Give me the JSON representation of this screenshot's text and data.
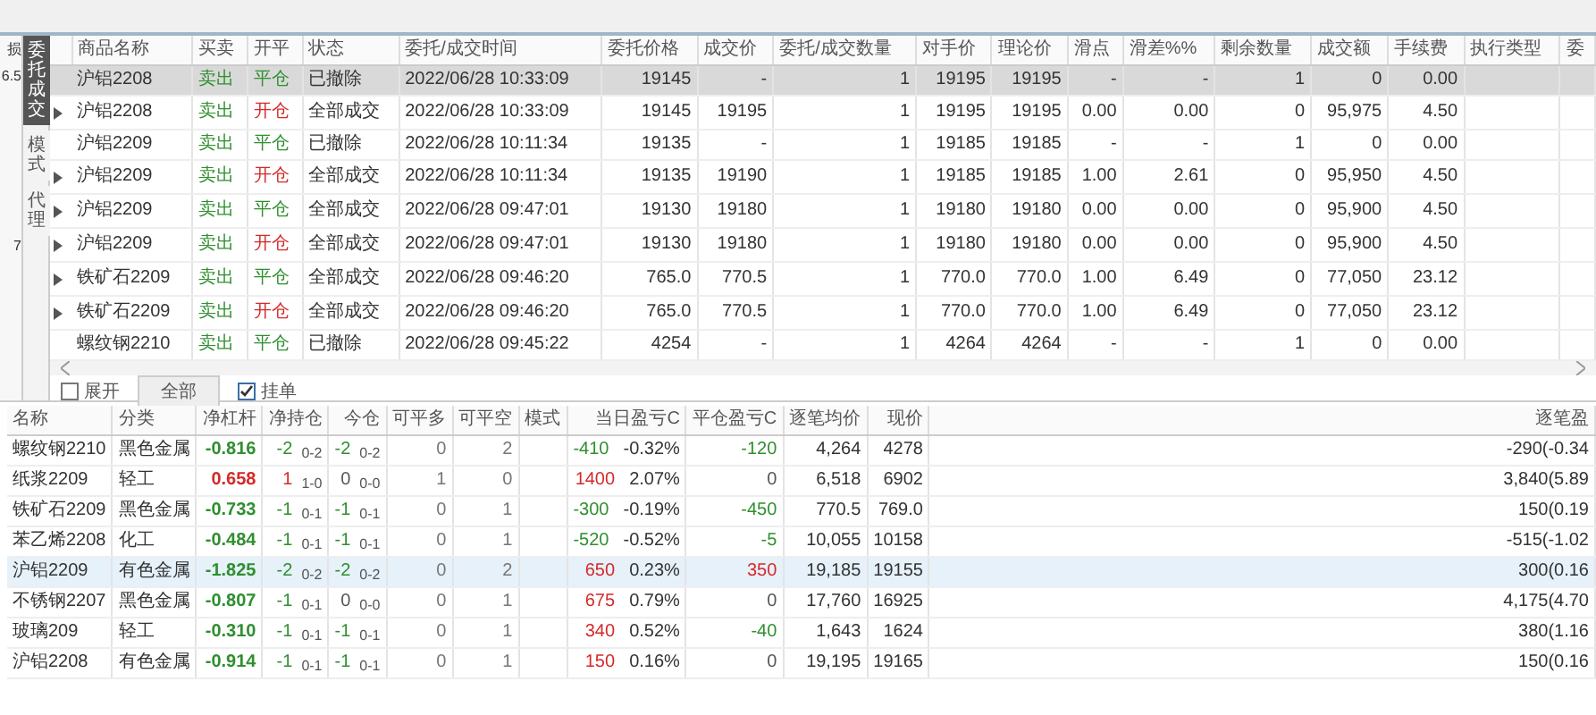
{
  "left_panel": {
    "header": "损",
    "value": "6.5",
    "footer": "7"
  },
  "side_tabs": [
    {
      "label": "委托成交",
      "selected": true
    },
    {
      "label": "模式",
      "selected": false
    },
    {
      "label": "代理",
      "selected": false
    }
  ],
  "orders": {
    "columns": [
      "商品名称",
      "买卖",
      "开平",
      "状态",
      "委托/成交时间",
      "委托价格",
      "成交价",
      "委托/成交数量",
      "对手价",
      "理论价",
      "滑点",
      "滑差%%",
      "剩余数量",
      "成交额",
      "手续费",
      "执行类型",
      "委"
    ],
    "rows": [
      {
        "expandable": false,
        "selected": true,
        "cells": [
          "沪铝2208",
          {
            "text": "卖出",
            "color": "#2f8f2f"
          },
          {
            "text": "平仓",
            "color": "#2f8f2f"
          },
          "已撤除",
          "2022/06/28 10:33:09",
          "19145",
          "-",
          "1",
          "19195",
          "19195",
          "-",
          "-",
          "1",
          "0",
          "0.00"
        ]
      },
      {
        "expandable": true,
        "selected": false,
        "cells": [
          "沪铝2208",
          {
            "text": "卖出",
            "color": "#2f8f2f"
          },
          {
            "text": "开仓",
            "color": "#d42a2a"
          },
          "全部成交",
          "2022/06/28 10:33:09",
          "19145",
          "19195",
          "1",
          "19195",
          "19195",
          "0.00",
          "0.00",
          "0",
          "95,975",
          "4.50"
        ]
      },
      {
        "expandable": false,
        "selected": false,
        "cells": [
          "沪铝2209",
          {
            "text": "卖出",
            "color": "#2f8f2f"
          },
          {
            "text": "平仓",
            "color": "#2f8f2f"
          },
          "已撤除",
          "2022/06/28 10:11:34",
          "19135",
          "-",
          "1",
          "19185",
          "19185",
          "-",
          "-",
          "1",
          "0",
          "0.00"
        ]
      },
      {
        "expandable": true,
        "selected": false,
        "cells": [
          "沪铝2209",
          {
            "text": "卖出",
            "color": "#2f8f2f"
          },
          {
            "text": "开仓",
            "color": "#d42a2a"
          },
          "全部成交",
          "2022/06/28 10:11:34",
          "19135",
          "19190",
          "1",
          "19185",
          "19185",
          "1.00",
          "2.61",
          "0",
          "95,950",
          "4.50"
        ]
      },
      {
        "expandable": true,
        "selected": false,
        "cells": [
          "沪铝2209",
          {
            "text": "卖出",
            "color": "#2f8f2f"
          },
          {
            "text": "平仓",
            "color": "#2f8f2f"
          },
          "全部成交",
          "2022/06/28 09:47:01",
          "19130",
          "19180",
          "1",
          "19180",
          "19180",
          "0.00",
          "0.00",
          "0",
          "95,900",
          "4.50"
        ]
      },
      {
        "expandable": true,
        "selected": false,
        "cells": [
          "沪铝2209",
          {
            "text": "卖出",
            "color": "#2f8f2f"
          },
          {
            "text": "开仓",
            "color": "#d42a2a"
          },
          "全部成交",
          "2022/06/28 09:47:01",
          "19130",
          "19180",
          "1",
          "19180",
          "19180",
          "0.00",
          "0.00",
          "0",
          "95,900",
          "4.50"
        ]
      },
      {
        "expandable": true,
        "selected": false,
        "cells": [
          "铁矿石2209",
          {
            "text": "卖出",
            "color": "#2f8f2f"
          },
          {
            "text": "平仓",
            "color": "#2f8f2f"
          },
          "全部成交",
          "2022/06/28 09:46:20",
          "765.0",
          "770.5",
          "1",
          "770.0",
          "770.0",
          "1.00",
          "6.49",
          "0",
          "77,050",
          "23.12"
        ]
      },
      {
        "expandable": true,
        "selected": false,
        "cells": [
          "铁矿石2209",
          {
            "text": "卖出",
            "color": "#2f8f2f"
          },
          {
            "text": "开仓",
            "color": "#d42a2a"
          },
          "全部成交",
          "2022/06/28 09:46:20",
          "765.0",
          "770.5",
          "1",
          "770.0",
          "770.0",
          "1.00",
          "6.49",
          "0",
          "77,050",
          "23.12"
        ]
      },
      {
        "expandable": false,
        "selected": false,
        "cells": [
          "螺纹钢2210",
          {
            "text": "卖出",
            "color": "#2f8f2f"
          },
          {
            "text": "平仓",
            "color": "#2f8f2f"
          },
          "已撤除",
          "2022/06/28 09:45:22",
          "4254",
          "-",
          "1",
          "4264",
          "4264",
          "-",
          "-",
          "1",
          "0",
          "0.00"
        ]
      }
    ]
  },
  "toolbar": [
    {
      "kind": "checkbox",
      "label": "展开",
      "checked": false
    },
    {
      "kind": "button",
      "label": "全部"
    },
    {
      "kind": "checkbox",
      "label": "挂单",
      "checked": true
    }
  ],
  "positions": {
    "columns": [
      "名称",
      "分类",
      "净杠杆",
      "净持仓",
      "今仓",
      "可平多",
      "可平空",
      "模式",
      "当日盈亏C",
      "平仓盈亏C",
      "逐笔均价",
      "现价",
      "逐笔盈"
    ],
    "rows": [
      {
        "selected": false,
        "cells": [
          "螺纹钢2210",
          "黑色金属",
          {
            "text": "-0.816",
            "color": "#2f8f2f"
          },
          {
            "value": "-2",
            "detail": "0-2",
            "color": "#2f8f2f"
          },
          {
            "value": "-2",
            "detail": "0-2",
            "color": "#2f8f2f"
          },
          "0",
          "2",
          "",
          {
            "value": "-410",
            "percent": "-0.32%",
            "color": "#2f8f2f"
          },
          {
            "text": "-120",
            "color": "#2f8f2f"
          },
          "4,264",
          "4278",
          "-290(-0.34"
        ]
      },
      {
        "selected": false,
        "cells": [
          "纸浆2209",
          "轻工",
          {
            "text": "0.658",
            "color": "#d42a2a"
          },
          {
            "value": "1",
            "detail": "1-0",
            "color": "#d42a2a"
          },
          {
            "value": "0",
            "detail": "0-0",
            "color": "#555555"
          },
          "1",
          "0",
          "",
          {
            "value": "1400",
            "percent": "2.07%",
            "color": "#d42a2a"
          },
          {
            "text": "0",
            "color": "#555555"
          },
          "6,518",
          "6902",
          "3,840(5.89"
        ]
      },
      {
        "selected": false,
        "cells": [
          "铁矿石2209",
          "黑色金属",
          {
            "text": "-0.733",
            "color": "#2f8f2f"
          },
          {
            "value": "-1",
            "detail": "0-1",
            "color": "#2f8f2f"
          },
          {
            "value": "-1",
            "detail": "0-1",
            "color": "#2f8f2f"
          },
          "0",
          "1",
          "",
          {
            "value": "-300",
            "percent": "-0.19%",
            "color": "#2f8f2f"
          },
          {
            "text": "-450",
            "color": "#2f8f2f"
          },
          "770.5",
          "769.0",
          "150(0.19"
        ]
      },
      {
        "selected": false,
        "cells": [
          "苯乙烯2208",
          "化工",
          {
            "text": "-0.484",
            "color": "#2f8f2f"
          },
          {
            "value": "-1",
            "detail": "0-1",
            "color": "#2f8f2f"
          },
          {
            "value": "-1",
            "detail": "0-1",
            "color": "#2f8f2f"
          },
          "0",
          "1",
          "",
          {
            "value": "-520",
            "percent": "-0.52%",
            "color": "#2f8f2f"
          },
          {
            "text": "-5",
            "color": "#2f8f2f"
          },
          "10,055",
          "10158",
          "-515(-1.02"
        ]
      },
      {
        "selected": true,
        "cells": [
          "沪铝2209",
          "有色金属",
          {
            "text": "-1.825",
            "color": "#2f8f2f"
          },
          {
            "value": "-2",
            "detail": "0-2",
            "color": "#2f8f2f"
          },
          {
            "value": "-2",
            "detail": "0-2",
            "color": "#2f8f2f"
          },
          "0",
          "2",
          "",
          {
            "value": "650",
            "percent": "0.23%",
            "color": "#d42a2a"
          },
          {
            "text": "350",
            "color": "#d42a2a"
          },
          "19,185",
          "19155",
          "300(0.16"
        ]
      },
      {
        "selected": false,
        "cells": [
          "不锈钢2207",
          "黑色金属",
          {
            "text": "-0.807",
            "color": "#2f8f2f"
          },
          {
            "value": "-1",
            "detail": "0-1",
            "color": "#2f8f2f"
          },
          {
            "value": "0",
            "detail": "0-0",
            "color": "#555555"
          },
          "0",
          "1",
          "",
          {
            "value": "675",
            "percent": "0.79%",
            "color": "#d42a2a"
          },
          {
            "text": "0",
            "color": "#555555"
          },
          "17,760",
          "16925",
          "4,175(4.70"
        ]
      },
      {
        "selected": false,
        "cells": [
          "玻璃209",
          "轻工",
          {
            "text": "-0.310",
            "color": "#2f8f2f"
          },
          {
            "value": "-1",
            "detail": "0-1",
            "color": "#2f8f2f"
          },
          {
            "value": "-1",
            "detail": "0-1",
            "color": "#2f8f2f"
          },
          "0",
          "1",
          "",
          {
            "value": "340",
            "percent": "0.52%",
            "color": "#d42a2a"
          },
          {
            "text": "-40",
            "color": "#2f8f2f"
          },
          "1,643",
          "1624",
          "380(1.16"
        ]
      },
      {
        "selected": false,
        "cells": [
          "沪铝2208",
          "有色金属",
          {
            "text": "-0.914",
            "color": "#2f8f2f"
          },
          {
            "value": "-1",
            "detail": "0-1",
            "color": "#2f8f2f"
          },
          {
            "value": "-1",
            "detail": "0-1",
            "color": "#2f8f2f"
          },
          "0",
          "1",
          "",
          {
            "value": "150",
            "percent": "0.16%",
            "color": "#d42a2a"
          },
          {
            "text": "0",
            "color": "#555555"
          },
          "19,195",
          "19165",
          "150(0.16"
        ]
      }
    ]
  }
}
